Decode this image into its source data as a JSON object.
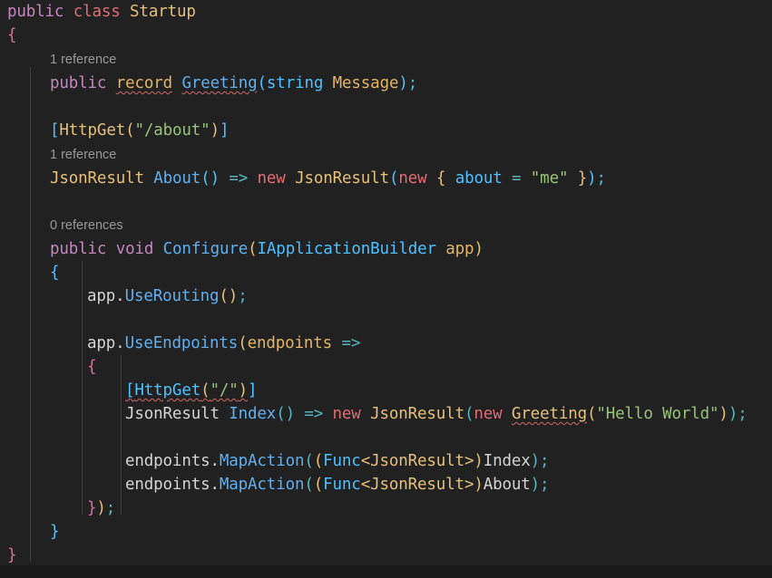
{
  "editor": {
    "language": "csharp",
    "theme": "dark-plus",
    "background_color": "#212121",
    "font_size_px": 17.5,
    "line_height_px": 26,
    "indent_guide_color": "#404040",
    "error_squiggle_color": "#d16969",
    "codelens_color": "#999999"
  },
  "code": {
    "l1_public": "public",
    "l1_class": "class",
    "l1_name": "Startup",
    "l2_brace": "{",
    "l3_codelens": "1 reference",
    "l4_public": "public",
    "l4_record": "record",
    "l4_type": "Greeting",
    "l4_paren_open": "(",
    "l4_string": "string",
    "l4_param": "Message",
    "l4_paren_close": ")",
    "l4_semi": ";",
    "l6_lbracket": "[",
    "l6_attr": "HttpGet",
    "l6_paren_open": "(",
    "l6_str": "\"/about\"",
    "l6_paren_close": ")",
    "l6_rbracket": "]",
    "l7_codelens": "1 reference",
    "l8_ret": "JsonResult",
    "l8_name": "About",
    "l8_parens": "()",
    "l8_arrow": "=>",
    "l8_new": "new",
    "l8_type": "JsonResult",
    "l8_paren_open": "(",
    "l8_new2": "new",
    "l8_brace_open": "{",
    "l8_prop": "about",
    "l8_eq": "=",
    "l8_val": "\"me\"",
    "l8_brace_close": "}",
    "l8_paren_close": ")",
    "l8_semi": ";",
    "l10_codelens": "0 references",
    "l11_public": "public",
    "l11_void": "void",
    "l11_name": "Configure",
    "l11_paren_open": "(",
    "l11_ptype": "IApplicationBuilder",
    "l11_pname": "app",
    "l11_paren_close": ")",
    "l12_brace": "{",
    "l13_obj": "app",
    "l13_dot": ".",
    "l13_meth": "UseRouting",
    "l13_parens": "()",
    "l13_semi": ";",
    "l15_obj": "app",
    "l15_dot": ".",
    "l15_meth": "UseEndpoints",
    "l15_paren_open": "(",
    "l15_param": "endpoints",
    "l15_arrow": "=>",
    "l16_brace": "{",
    "l17_lbracket": "[",
    "l17_attr": "HttpGet",
    "l17_paren_open": "(",
    "l17_str": "\"/\"",
    "l17_paren_close": ")",
    "l17_rbracket": "]",
    "l18_ret": "JsonResult",
    "l18_name": "Index",
    "l18_parens": "()",
    "l18_arrow": "=>",
    "l18_new": "new",
    "l18_type": "JsonResult",
    "l18_paren_open": "(",
    "l18_new2": "new",
    "l18_greeting": "Greeting",
    "l18_paren_open2": "(",
    "l18_str": "\"Hello World\"",
    "l18_paren_close2": ")",
    "l18_paren_close": ")",
    "l18_semi": ";",
    "l20_obj": "endpoints",
    "l20_dot": ".",
    "l20_meth": "MapAction",
    "l20_paren_open": "(",
    "l20_cast_open": "(",
    "l20_func": "Func",
    "l20_lt": "<",
    "l20_generic": "JsonResult",
    "l20_gt": ">",
    "l20_cast_close": ")",
    "l20_arg": "Index",
    "l20_paren_close": ")",
    "l20_semi": ";",
    "l21_obj": "endpoints",
    "l21_dot": ".",
    "l21_meth": "MapAction",
    "l21_paren_open": "(",
    "l21_cast_open": "(",
    "l21_func": "Func",
    "l21_lt": "<",
    "l21_generic": "JsonResult",
    "l21_gt": ">",
    "l21_cast_close": ")",
    "l21_arg": "About",
    "l21_paren_close": ")",
    "l21_semi": ";",
    "l23_brace_close": "}",
    "l23_paren_close": ")",
    "l23_semi": ";",
    "l24_brace": "}",
    "l25_brace": "}"
  }
}
